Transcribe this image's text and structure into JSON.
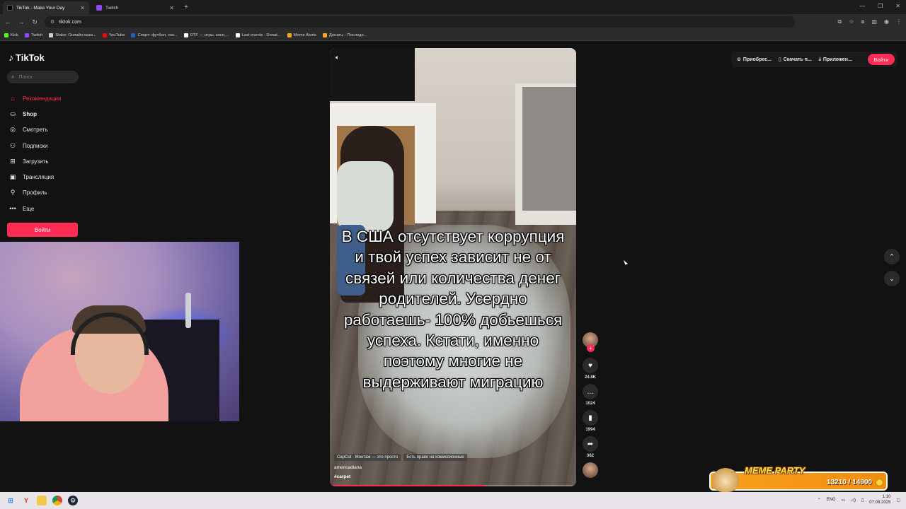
{
  "browser": {
    "tabs": [
      {
        "title": "TikTok - Make Your Day",
        "color": "#111111",
        "active": true
      },
      {
        "title": "Twitch",
        "color": "#9146ff",
        "active": false
      }
    ],
    "new_tab_icon": "plus-icon",
    "url": "tiktok.com",
    "bookmarks": [
      {
        "label": "Kick",
        "color": "#53fc18"
      },
      {
        "label": "Twitch",
        "color": "#9146ff"
      },
      {
        "label": "Stake: Онлайн-кази...",
        "color": "#cccccc"
      },
      {
        "label": "YouTube",
        "color": "#ff0000"
      },
      {
        "label": "Спорт: футбол, хок...",
        "color": "#1f5fbf"
      },
      {
        "label": "DTF — игры, кино,...",
        "color": "#ffffff"
      },
      {
        "label": "Last events - Donat...",
        "color": "#ffffff"
      },
      {
        "label": "Meme Alerts",
        "color": "#f5a623"
      },
      {
        "label": "Донаты - Последн...",
        "color": "#f5a623"
      }
    ]
  },
  "sidebar": {
    "logo": "TikTok",
    "search_placeholder": "Поиск",
    "items": [
      {
        "label": "Рекомендации",
        "icon": "home-icon",
        "glyph": "⌂",
        "active": true
      },
      {
        "label": "Shop",
        "icon": "shop-bag-icon",
        "glyph": "⛀",
        "bold": true
      },
      {
        "label": "Смотреть",
        "icon": "compass-icon",
        "glyph": "◎"
      },
      {
        "label": "Подписки",
        "icon": "following-icon",
        "glyph": "⚇"
      },
      {
        "label": "Загрузить",
        "icon": "upload-icon",
        "glyph": "⊞"
      },
      {
        "label": "Трансляция",
        "icon": "live-icon",
        "glyph": "▣"
      },
      {
        "label": "Профиль",
        "icon": "profile-icon",
        "glyph": "⚲"
      },
      {
        "label": "Еще",
        "icon": "more-icon",
        "glyph": "•••"
      }
    ],
    "login_label": "Войти"
  },
  "video": {
    "caption": "В США отсутствует коррупция и твой успех зависит не от связей или количества денег родителей. Усердно работаешь- 100% добьешься успеха. Кстати, именно поэтому многие не выдерживают миграцию",
    "tags": [
      "CapCut · Монтаж — это просто",
      "Есть право на комиссионные"
    ],
    "author": "americadiana",
    "hashtag": "#carpet",
    "progress": 0.63
  },
  "actions": {
    "likes": "24.8K",
    "comments": "1024",
    "saves": "1994",
    "shares": "362"
  },
  "topright": {
    "items": [
      {
        "label": "Приобрес...",
        "icon": "coin-icon",
        "glyph": "⊙"
      },
      {
        "label": "Скачать п...",
        "icon": "phone-icon",
        "glyph": "▯"
      },
      {
        "label": "Приложен...",
        "icon": "download-icon",
        "glyph": "⤓"
      }
    ],
    "login_label": "Войти"
  },
  "widget": {
    "title": "MEME PARTY",
    "score": "13210 / 14900"
  },
  "taskbar": {
    "lang": "ENG",
    "time": "1:10",
    "date": "07.08.2025"
  }
}
